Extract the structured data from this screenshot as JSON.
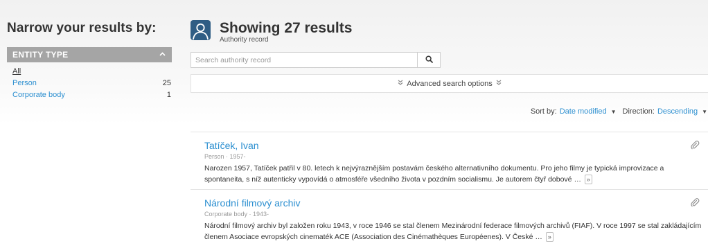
{
  "sidebar": {
    "title": "Narrow your results by:",
    "facet": {
      "label": "Entity type",
      "items": [
        {
          "label": "All",
          "count": ""
        },
        {
          "label": "Person",
          "count": "25"
        },
        {
          "label": "Corporate body",
          "count": "1"
        }
      ]
    }
  },
  "header": {
    "title": "Showing 27 results",
    "subtitle": "Authority record",
    "icon": "person-icon"
  },
  "search": {
    "placeholder": "Search authority record",
    "value": "",
    "button_icon": "search-icon"
  },
  "advanced": {
    "label": "Advanced search options",
    "icon": "double-chevron-down-icon"
  },
  "sort": {
    "sort_label": "Sort by:",
    "sort_value": "Date modified",
    "direction_label": "Direction:",
    "direction_value": "Descending"
  },
  "results": [
    {
      "title": "Tatíček, Ivan",
      "meta": "Person · 1957-",
      "description": "Narozen 1957, Tatíček patřil v 80. letech k nejvýraznějším postavám českého alternativního dokumentu. Pro jeho filmy je typická improvizace a spontaneita, s níž autenticky vypovídá o atmosféře všedního života v pozdním socialismu. Je autorem čtyř dobové …",
      "more_label": "»",
      "icon": "paperclip-icon"
    },
    {
      "title": "Národní filmový archiv",
      "meta": "Corporate body · 1943-",
      "description": "Národní filmový archiv byl založen roku 1943, v roce 1946 se stal členem Mezinárodní federace filmových archivů (FIAF). V roce 1997 se stal zakládajícím členem Asociace evropských cinematék ACE (Association des Cinémathèques Européenes). V České …",
      "more_label": "»",
      "icon": "paperclip-icon"
    }
  ],
  "colors": {
    "link": "#2c8fd0",
    "facet_header": "#a5a5a5",
    "avatar_bg": "#2f5d84"
  }
}
